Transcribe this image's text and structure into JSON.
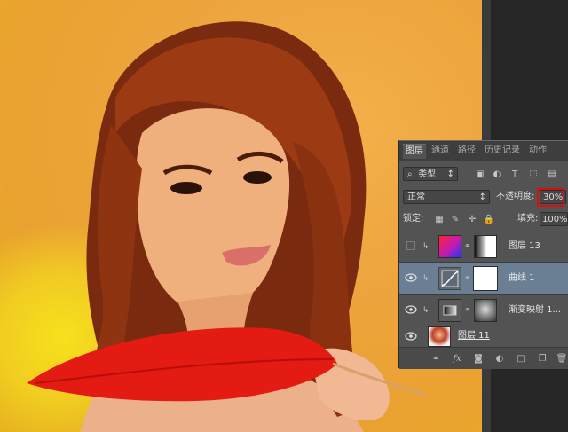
{
  "panel": {
    "tabs": [
      {
        "label": "图层"
      },
      {
        "label": "通道"
      },
      {
        "label": "路径"
      },
      {
        "label": "历史记录"
      },
      {
        "label": "动作"
      }
    ],
    "filter_kind": "类型",
    "blend_mode": "正常",
    "opacity_label": "不透明度:",
    "opacity_value": "30%",
    "lock_label": "锁定:",
    "fill_label": "填充:",
    "fill_value": "100%",
    "layers": [
      {
        "name": "图层 13",
        "visible": false,
        "selected": false
      },
      {
        "name": "曲线 1",
        "visible": true,
        "selected": true
      },
      {
        "name": "渐变映射 1...",
        "visible": true,
        "selected": false
      },
      {
        "name": "图层 11",
        "visible": true,
        "selected": false
      }
    ]
  },
  "colors": {
    "background_orange": "#eda43d",
    "panel_bg": "#535353",
    "selected_row": "#6a7f94",
    "highlight_red": "#e10b0b"
  },
  "icons": {
    "filter": "search-icon",
    "eye": "eye-icon",
    "link": "chain-link-icon",
    "bottom": [
      "link-layers-icon",
      "fx-icon",
      "add-mask-icon",
      "adjustment-layer-icon",
      "new-group-icon",
      "new-layer-icon",
      "trash-icon"
    ]
  }
}
